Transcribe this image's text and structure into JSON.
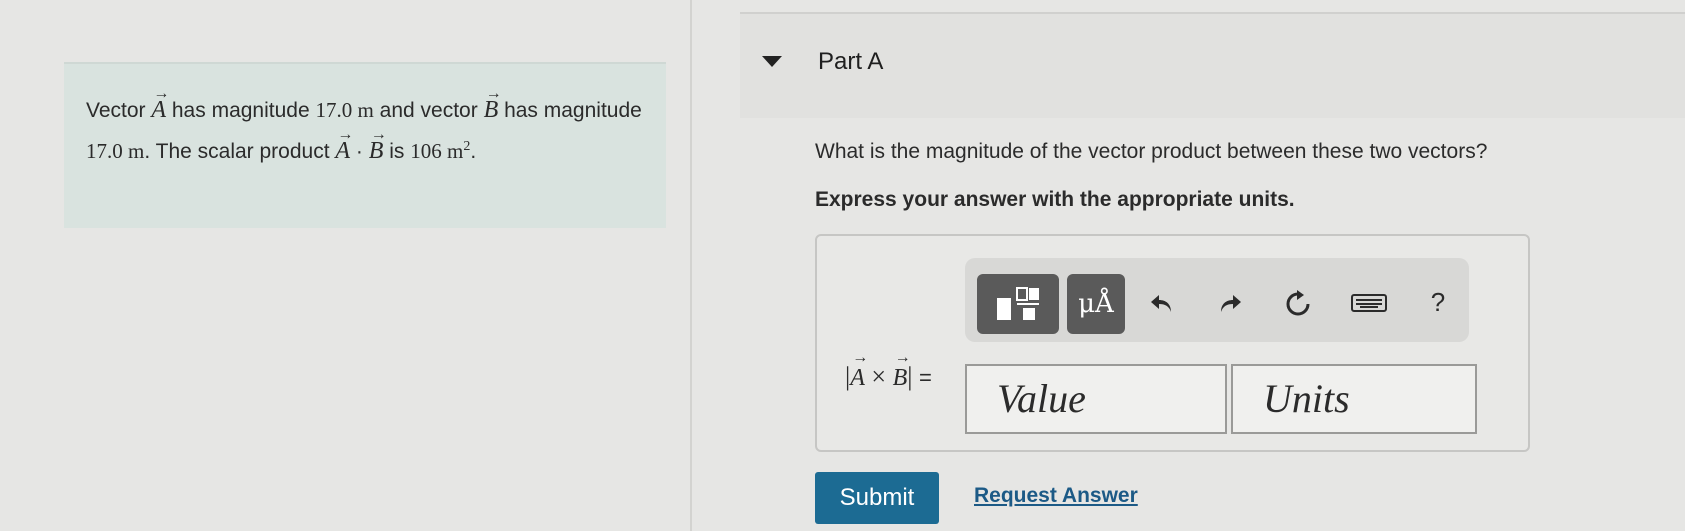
{
  "problem": {
    "t1": "Vector ",
    "vecA": "A",
    "t2": " has magnitude ",
    "magA": "17.0 m",
    "t3": " and vector ",
    "vecB": "B",
    "t4": " has magnitude ",
    "magB": "17.0 m",
    "t5": ". The scalar product ",
    "dotA": "A",
    "dot": " · ",
    "dotB": "B",
    "t6": " is ",
    "val": "106 m",
    "exp": "2",
    "end": "."
  },
  "part": {
    "title": "Part A"
  },
  "question": "What is the magnitude of the vector product between these two vectors?",
  "instruction": "Express your answer with the appropriate units.",
  "toolbar": {
    "units_label": "μÅ",
    "help_label": "?",
    "icons": [
      "fraction-template-icon",
      "undo-icon",
      "redo-icon",
      "reset-icon",
      "keyboard-icon"
    ]
  },
  "answer": {
    "lhs_A": "A",
    "times": "×",
    "lhs_B": "B",
    "equals": "=",
    "value_placeholder": "Value",
    "units_placeholder": "Units"
  },
  "actions": {
    "submit": "Submit",
    "request": "Request Answer"
  },
  "colors": {
    "submit_bg": "#1c6b93",
    "problem_bg": "#d9e3df"
  }
}
